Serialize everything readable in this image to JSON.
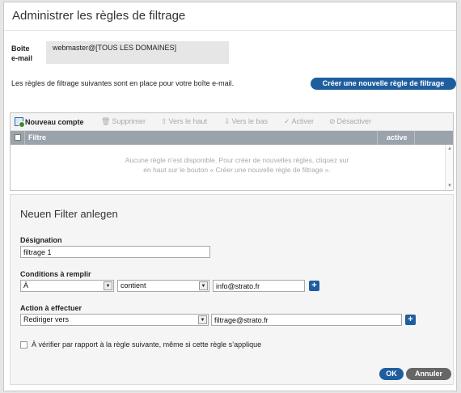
{
  "header": {
    "title": "Administrer les règles de filtrage"
  },
  "mailbox": {
    "label_line1": "Boîte",
    "label_line2": "e-mail",
    "value": "webmaster@[TOUS LES DOMAINES]"
  },
  "intro": {
    "text": "Les règles de filtrage suivantes sont en place pour votre boîte e-mail."
  },
  "new_rule_button": "Créer une nouvelle règle de filtrage",
  "toolbar": {
    "new_account": "Nouveau compte",
    "delete": "Supprimer",
    "up": "Vers le haut",
    "down": "Vers le bas",
    "activate": "Activer",
    "deactivate": "Désactiver"
  },
  "table": {
    "col_filter": "Filtre",
    "col_active": "active",
    "empty_line1": "Aucune règle n’est disponible. Pour créer de nouvelles règles, cliquez sur",
    "empty_line2": "en haut sur le bouton « Créer une nouvelle règle de filtrage »."
  },
  "form": {
    "title": "Neuen Filter anlegen",
    "designation_label": "Désignation",
    "designation_value": "filtrage 1",
    "conditions_label": "Conditions à remplir",
    "condition_field": "À",
    "condition_operator": "contient",
    "condition_value": "info@strato.fr",
    "action_label": "Action à effectuer",
    "action_type": "Rediriger vers",
    "action_value": "filtrage@strato.fr",
    "checkbox_label": "À vérifier par rapport à la règle suivante, même si cette règle s’applique",
    "ok_label": "OK",
    "cancel_label": "Annuler"
  },
  "colors": {
    "accent": "#1f5e9e",
    "header_bar": "#9aa2ab"
  }
}
